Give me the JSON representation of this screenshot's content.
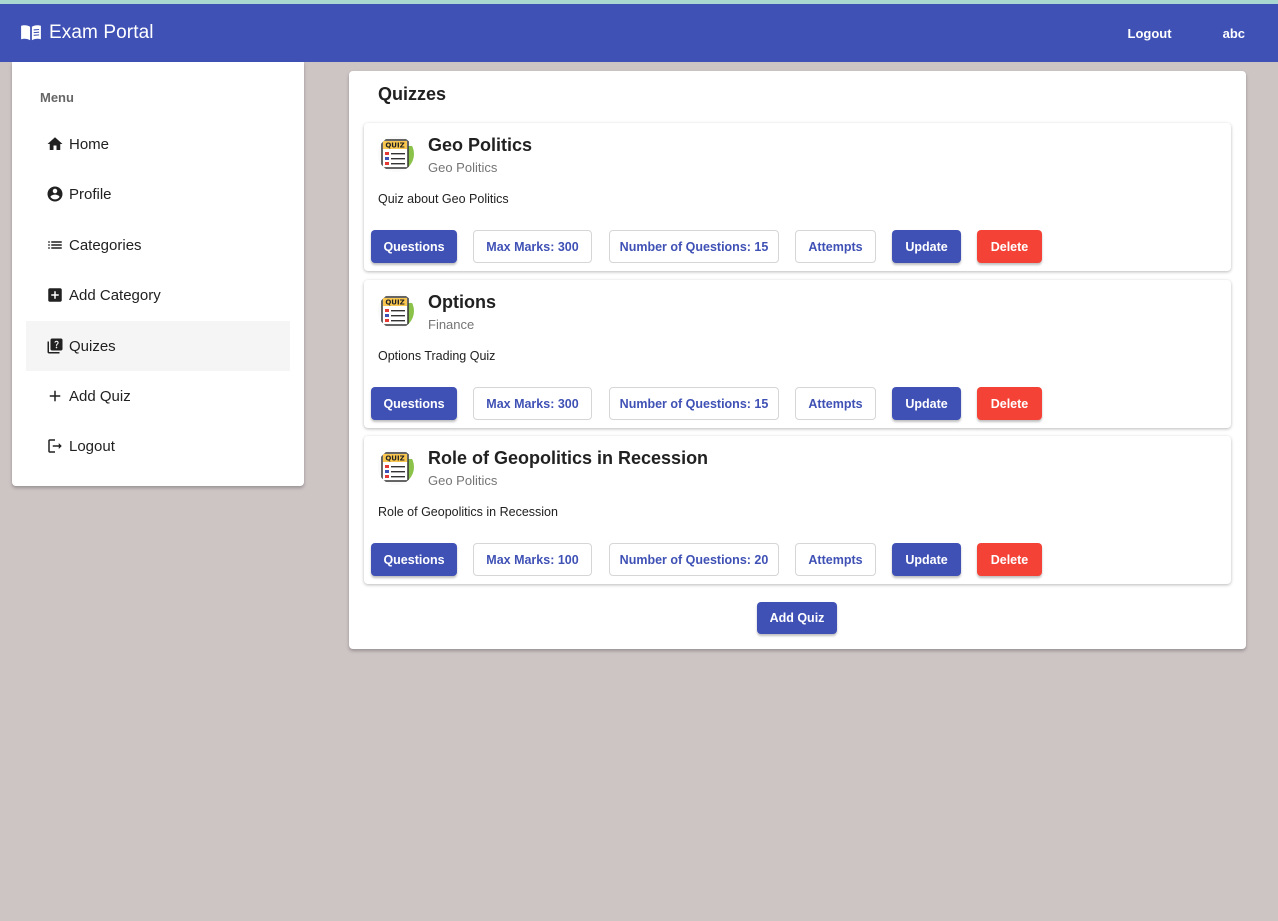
{
  "navbar": {
    "brand_icon": "book-icon",
    "title": "Exam Portal",
    "logout_label": "Logout",
    "user_label": "abc",
    "color": "#3f51b5"
  },
  "sidebar": {
    "heading": "Menu",
    "items": [
      {
        "label": "Home",
        "icon": "home-icon"
      },
      {
        "label": "Profile",
        "icon": "account-circle-icon"
      },
      {
        "label": "Categories",
        "icon": "list-icon"
      },
      {
        "label": "Add Category",
        "icon": "add-box-icon"
      },
      {
        "label": "Quizes",
        "icon": "quiz-icon",
        "active": true
      },
      {
        "label": "Add Quiz",
        "icon": "plus-icon"
      },
      {
        "label": "Logout",
        "icon": "logout-icon"
      }
    ]
  },
  "main": {
    "title": "Quizzes",
    "quizzes": [
      {
        "title": "Geo Politics",
        "category": "Geo Politics",
        "description": "Quiz about Geo Politics",
        "questions_label": "Questions",
        "max_marks_label": "Max Marks: 300",
        "num_questions_label": "Number of Questions: 15",
        "attempts_label": "Attempts",
        "update_label": "Update",
        "delete_label": "Delete"
      },
      {
        "title": "Options",
        "category": "Finance",
        "description": "Options Trading Quiz",
        "questions_label": "Questions",
        "max_marks_label": "Max Marks: 300",
        "num_questions_label": "Number of Questions: 15",
        "attempts_label": "Attempts",
        "update_label": "Update",
        "delete_label": "Delete"
      },
      {
        "title": "Role of Geopolitics in Recession",
        "category": "Geo Politics",
        "description": "Role of Geopolitics in Recession",
        "questions_label": "Questions",
        "max_marks_label": "Max Marks: 100",
        "num_questions_label": "Number of Questions: 20",
        "attempts_label": "Attempts",
        "update_label": "Update",
        "delete_label": "Delete"
      }
    ],
    "add_quiz_label": "Add Quiz"
  },
  "colors": {
    "primary": "#3f51b5",
    "warn": "#f44336",
    "background": "#cdc4c4"
  }
}
